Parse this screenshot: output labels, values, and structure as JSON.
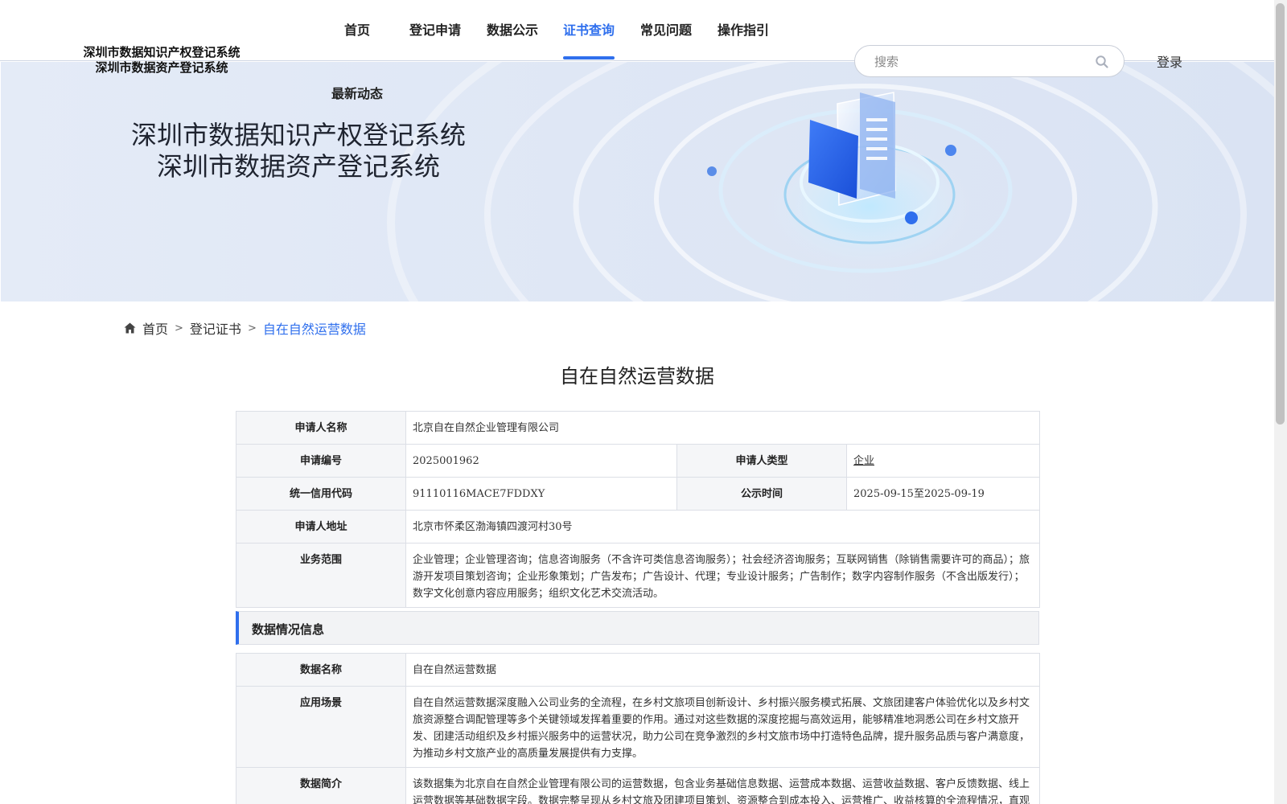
{
  "header": {
    "logo_line1": "深圳市数据知识产权登记系统",
    "logo_line2": "深圳市数据资产登记系统",
    "nav": [
      {
        "label": "首页"
      },
      {
        "label": "登记申请"
      },
      {
        "label": "数据公示"
      },
      {
        "label": "证书查询",
        "active": true
      },
      {
        "label": "常见问题"
      },
      {
        "label": "操作指引"
      }
    ],
    "nav_latest": "最新动态",
    "search_placeholder": "搜索",
    "login": "登录",
    "accent_color": "#2f6fed"
  },
  "banner": {
    "title_line1": "深圳市数据知识产权登记系统",
    "title_line2": "深圳市数据资产登记系统"
  },
  "breadcrumb": {
    "home": "首页",
    "level2": "登记证书",
    "current": "自在自然运营数据"
  },
  "page_title": "自在自然运营数据",
  "applicant": {
    "name_label": "申请人名称",
    "name": "北京自在自然企业管理有限公司",
    "number_label": "申请编号",
    "number": "2025001962",
    "type_label": "申请人类型",
    "type": "企业",
    "credit_label": "统一信用代码",
    "credit": "91110116MACE7FDDXY",
    "period_label": "公示时间",
    "period": "2025-09-15至2025-09-19",
    "address_label": "申请人地址",
    "address": "北京市怀柔区渤海镇四渡河村30号",
    "scope_label": "业务范围",
    "scope": "企业管理；企业管理咨询；信息咨询服务（不含许可类信息咨询服务）；社会经济咨询服务；互联网销售（除销售需要许可的商品）；旅游开发项目策划咨询；企业形象策划；广告发布；广告设计、代理；专业设计服务；广告制作；数字内容制作服务（不含出版发行）；数字文化创意内容应用服务；组织文化艺术交流活动。"
  },
  "data_section": {
    "title": "数据情况信息",
    "data_name_label": "数据名称",
    "data_name": "自在自然运营数据",
    "scenario_label": "应用场景",
    "scenario": "自在自然运营数据深度融入公司业务的全流程，在乡村文旅项目创新设计、乡村振兴服务模式拓展、文旅团建客户体验优化以及乡村文旅资源整合调配管理等多个关键领域发挥着重要的作用。通过对这些数据的深度挖掘与高效运用，能够精准地洞悉公司在乡村文旅开发、团建活动组织及乡村振兴服务中的运营状况，助力公司在竞争激烈的乡村文旅市场中打造特色品牌，提升服务品质与客户满意度，为推动乡村文旅产业的高质量发展提供有力支撑。",
    "intro_label": "数据简介",
    "intro": "该数据集为北京自在自然企业管理有限公司的运营数据，包含业务基础信息数据、运营成本数据、运营收益数据、客户反馈数据、线上运营数据等基础数据字段。数据完整呈现从乡村文旅及团建项目策划、资源整合到成本投入、运营推广、收益核算的全流程情况，直观反映不同项目的经营效益与市场表现。这些数据不仅为公司精准分析各项目的市场表现提供了可靠支撑，更"
  }
}
